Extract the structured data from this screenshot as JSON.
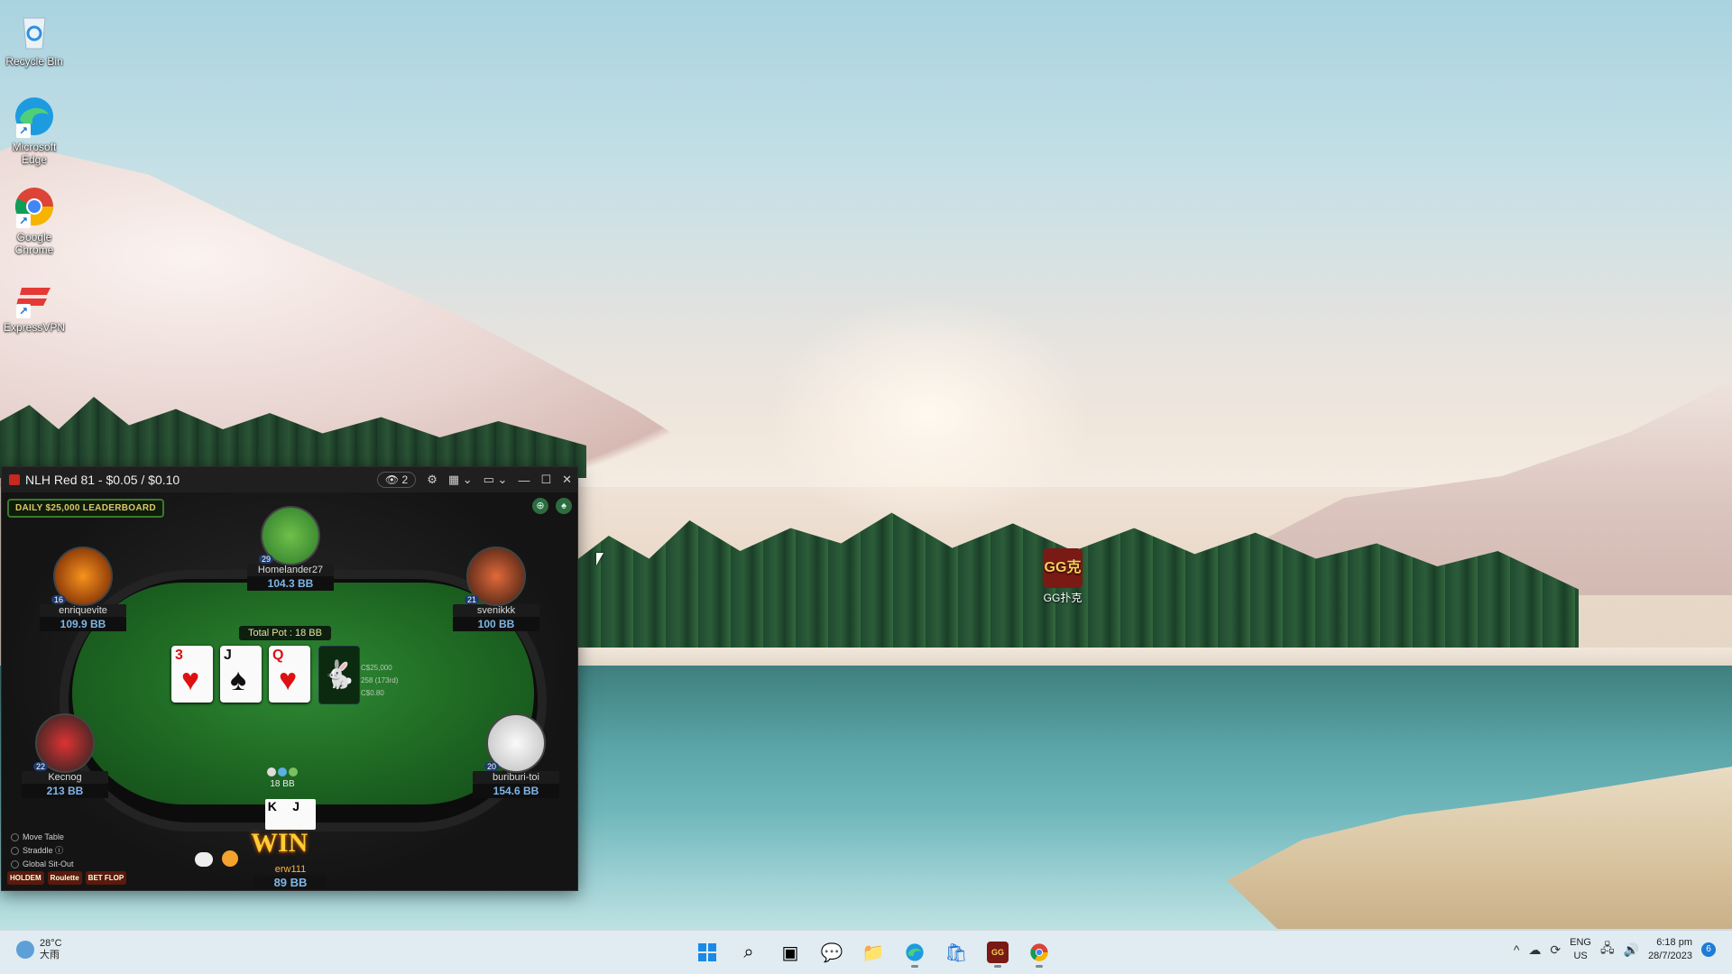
{
  "desktop": {
    "icons": [
      {
        "label": "Recycle Bin",
        "icon": "recycle-bin-icon"
      },
      {
        "label": "Microsoft Edge",
        "icon": "edge-icon"
      },
      {
        "label": "Google Chrome",
        "icon": "chrome-icon"
      },
      {
        "label": "ExpressVPN",
        "icon": "expressvpn-icon"
      }
    ],
    "gg_icon": {
      "label": "GG扑克",
      "logo_text": "GG克"
    }
  },
  "poker_window": {
    "title": "NLH Red 81 - $0.05 / $0.10",
    "observers": "2",
    "leaderboard": "DAILY $25,000 LEADERBOARD",
    "total_pot": "Total Pot : 18 BB",
    "board": [
      {
        "rank": "3",
        "suit": "♥",
        "color": "red"
      },
      {
        "rank": "J",
        "suit": "♠",
        "color": "black"
      },
      {
        "rank": "Q",
        "suit": "♥",
        "color": "red"
      }
    ],
    "stats": [
      "C$25,000",
      "258 (173rd)",
      "C$0.80"
    ],
    "pot_chips": "18 BB",
    "seats": [
      {
        "name": "Homelander27",
        "stack": "104.3 BB",
        "level": "29"
      },
      {
        "name": "enriquevite",
        "stack": "109.9 BB",
        "level": "16"
      },
      {
        "name": "svenikkk",
        "stack": "100 BB",
        "level": "21"
      },
      {
        "name": "Kecnog",
        "stack": "213 BB",
        "level": "22"
      },
      {
        "name": "buriburi-toi",
        "stack": "154.6 BB",
        "level": "20"
      }
    ],
    "hero": {
      "name": "erw111",
      "stack": "89 BB",
      "cards": [
        "K",
        "J"
      ],
      "banner": "WIN"
    },
    "options": [
      "Move Table",
      "Straddle",
      "Global Sit-Out"
    ],
    "games": [
      "HOLDEM",
      "Roulette",
      "BET FLOP"
    ]
  },
  "taskbar": {
    "weather_temp": "28°C",
    "weather_desc": "大雨",
    "apps": [
      "start-icon",
      "search-icon",
      "task-view-icon",
      "chat-icon",
      "file-explorer-icon",
      "edge-icon",
      "store-icon",
      "gg-poker-icon",
      "chrome-icon"
    ],
    "lang_top": "ENG",
    "lang_bottom": "US",
    "time": "6:18 pm",
    "date": "28/7/2023",
    "notifications": "6"
  }
}
